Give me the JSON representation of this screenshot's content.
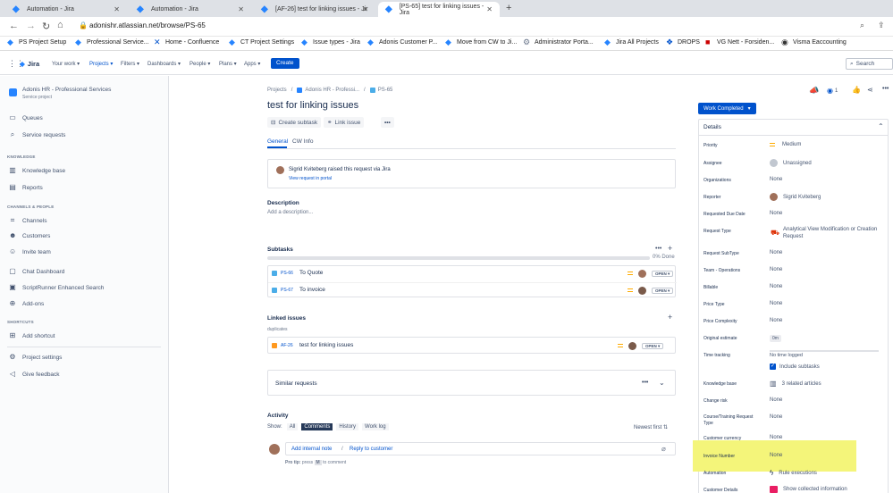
{
  "browser": {
    "tabs": [
      "Automation - Jira",
      "Automation - Jira",
      "[AF-26] test for linking issues - Jir",
      "[PS-65] test for linking issues - Jira"
    ],
    "url": "adonishr.atlassian.net/browse/PS-65",
    "bookmarks": [
      "PS Project Setup",
      "Professional Service...",
      "Home - Confluence",
      "CT Project Settings",
      "Issue types - Jira",
      "Adonis Customer P...",
      "Move from CW to Ji...",
      "Administrator Porta...",
      "Jira All Projects",
      "DROPS",
      "VG Nett - Forsiden...",
      "Visma Eaccounting"
    ]
  },
  "nav": {
    "logo": "Jira",
    "items": [
      "Your work",
      "Projects",
      "Filters",
      "Dashboards",
      "People",
      "Plans",
      "Apps"
    ],
    "create": "Create",
    "search_placeholder": "Search"
  },
  "sidebar": {
    "project_name": "Adonis HR - Professional Services",
    "project_type": "Service project",
    "items_top": [
      "Queues",
      "Service requests"
    ],
    "knowledge_header": "KNOWLEDGE",
    "knowledge_items": [
      "Knowledge base",
      "Reports"
    ],
    "channels_header": "CHANNELS & PEOPLE",
    "channels_items": [
      "Channels",
      "Customers",
      "Invite team"
    ],
    "other_items": [
      "Chat Dashboard",
      "ScriptRunner Enhanced Search",
      "Add-ons"
    ],
    "shortcuts_header": "SHORTCUTS",
    "add_shortcut": "Add shortcut",
    "project_settings": "Project settings",
    "give_feedback": "Give feedback"
  },
  "issue": {
    "breadcrumb": [
      "Projects",
      "Adonis HR - Professi...",
      "PS-65"
    ],
    "title": "test for linking issues",
    "create_subtask": "Create subtask",
    "link_issue": "Link issue",
    "tabs": [
      "General",
      "CW Info"
    ],
    "raised_by": "Sigrid Kviteberg",
    "raised_text": "raised this request via Jira",
    "view_portal": "View request in portal",
    "description_label": "Description",
    "description_placeholder": "Add a description...",
    "subtasks_label": "Subtasks",
    "subtasks_done": "0% Done",
    "subtasks": [
      {
        "key": "PS-66",
        "summary": "To Quote",
        "status": "OPEN"
      },
      {
        "key": "PS-67",
        "summary": "To invoice",
        "status": "OPEN"
      }
    ],
    "linked_label": "Linked issues",
    "linked_relation": "duplicates",
    "linked": {
      "key": "AF-26",
      "summary": "test for linking issues",
      "status": "OPEN"
    },
    "similar": "Similar requests",
    "activity_label": "Activity",
    "show_label": "Show:",
    "activity_tabs": [
      "All",
      "Comments",
      "History",
      "Work log"
    ],
    "sort": "Newest first",
    "add_internal_note": "Add internal note",
    "slash": "/",
    "reply_customer": "Reply to customer",
    "pro_tip_bold": "Pro tip:",
    "pro_tip_pre": "press",
    "pro_tip_key": "M",
    "pro_tip_post": "to comment"
  },
  "details": {
    "watch_count": "1",
    "status_button": "Work Completed",
    "header": "Details",
    "fields": [
      {
        "label": "Priority",
        "value": "Medium"
      },
      {
        "label": "Assignee",
        "value": "Unassigned"
      },
      {
        "label": "Organizations",
        "value": "None"
      },
      {
        "label": "Reporter",
        "value": "Sigrid Kviteberg"
      },
      {
        "label": "Requested Due Date",
        "value": "None"
      },
      {
        "label": "Request Type",
        "value": "Analytical View Modification or Creation Request"
      },
      {
        "label": "Request SubType",
        "value": "None"
      },
      {
        "label": "Team - Operations",
        "value": "None"
      },
      {
        "label": "Billable",
        "value": "None"
      },
      {
        "label": "Price Type",
        "value": "None"
      },
      {
        "label": "Price Complexity",
        "value": "None"
      },
      {
        "label": "Original estimate",
        "value": "0m"
      },
      {
        "label": "Time tracking",
        "value": "No time logged"
      },
      {
        "label": "Knowledge base",
        "value": "3 related articles"
      },
      {
        "label": "Change risk",
        "value": "None"
      },
      {
        "label": "Course/Training Request Type",
        "value": "None"
      },
      {
        "label": "Customer currency",
        "value": "None"
      },
      {
        "label": "Invoice Number",
        "value": "None"
      },
      {
        "label": "Automation",
        "value": "Rule executions"
      },
      {
        "label": "Customer Details",
        "value": "Show collected information"
      }
    ],
    "include_subtasks": "Include subtasks",
    "highlight_color": "#f4f57a"
  }
}
